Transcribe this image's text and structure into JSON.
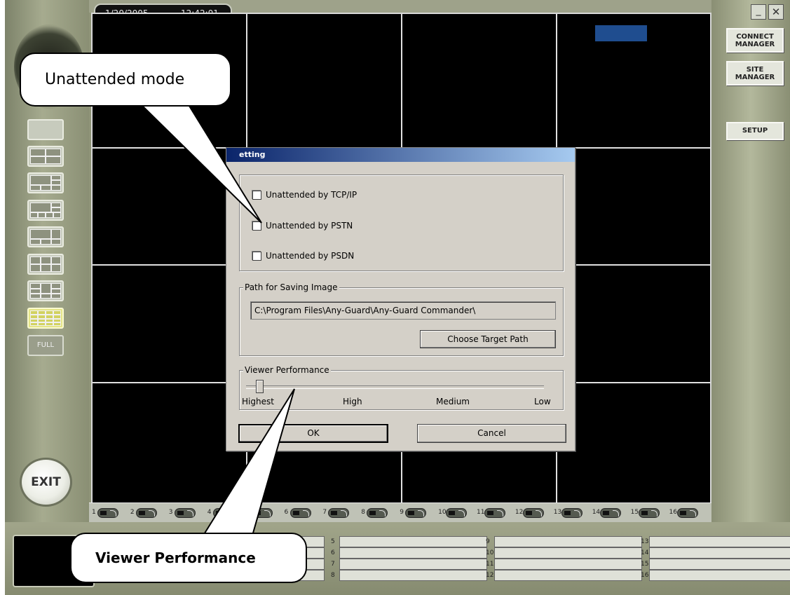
{
  "topbar": {
    "date": "1/20/2005",
    "time": "12:42:01"
  },
  "window_controls": {
    "minimize": "_",
    "close": "✕"
  },
  "right_buttons": {
    "connect_manager_line1": "CONNECT",
    "connect_manager_line2": "MANAGER",
    "site_manager_line1": "SITE",
    "site_manager_line2": "MANAGER",
    "setup": "SETUP"
  },
  "left_buttons": {
    "full": "FULL",
    "exit": "EXIT"
  },
  "cameras": [
    "1",
    "2",
    "3",
    "4",
    "5",
    "6",
    "7",
    "8",
    "9",
    "10",
    "11",
    "12",
    "13",
    "14",
    "15",
    "16"
  ],
  "status_numbers": [
    "5",
    "6",
    "7",
    "8",
    "9",
    "10",
    "11",
    "12",
    "13",
    "14",
    "15",
    "16"
  ],
  "dialog": {
    "title": "etting",
    "unattended_options": [
      "Unattended by TCP/IP",
      "Unattended by PSTN",
      "Unattended by PSDN"
    ],
    "path_group_label": "Path for Saving Image",
    "path_value": "C:\\Program Files\\Any-Guard\\Any-Guard Commander\\",
    "choose_path_button": "Choose Target Path",
    "performance_group_label": "Viewer Performance",
    "performance_levels": [
      "Highest",
      "High",
      "Medium",
      "Low"
    ],
    "performance_selected": "Highest",
    "ok_button": "OK",
    "cancel_button": "Cancel"
  },
  "callouts": {
    "unattended": "Unattended mode",
    "viewer": "Viewer Performance"
  },
  "colors": {
    "frame": "#8f9478",
    "dialog_bg": "#d4d0c8",
    "title_blue": "#0a246a",
    "active_layout": "#e4e486",
    "blue_block": "#1f4d8f"
  }
}
